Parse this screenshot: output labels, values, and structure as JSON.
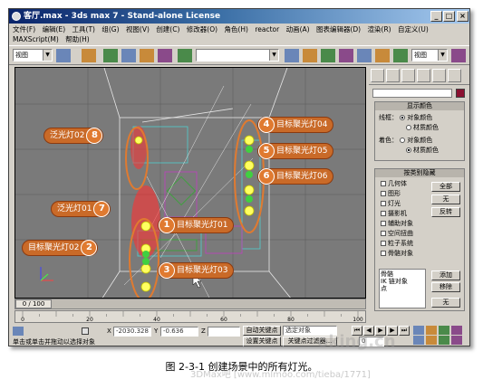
{
  "window": {
    "title": "客厅.max - 3ds max 7 - Stand-alone License"
  },
  "menu": [
    "文件(F)",
    "编辑(E)",
    "工具(T)",
    "组(G)",
    "视图(V)",
    "创建(C)",
    "修改器(O)",
    "角色(H)",
    "reactor",
    "动画(A)",
    "图表编辑器(D)",
    "渲染(R)",
    "自定义(U)",
    "MAXScript(M)",
    "帮助(H)"
  ],
  "toolbar": {
    "view_combo_left": "视图",
    "view_combo_right": "视图",
    "selection_set": ""
  },
  "callouts": [
    {
      "num": "1",
      "label": "目标聚光灯01"
    },
    {
      "num": "2",
      "label": "目标聚光灯02"
    },
    {
      "num": "3",
      "label": "目标聚光灯03"
    },
    {
      "num": "4",
      "label": "目标聚光灯04"
    },
    {
      "num": "5",
      "label": "目标聚光灯05"
    },
    {
      "num": "6",
      "label": "目标聚光灯06"
    },
    {
      "num": "7",
      "label": "泛光灯01"
    },
    {
      "num": "8",
      "label": "泛光灯02"
    }
  ],
  "panel": {
    "display_color": {
      "header": "显示颜色",
      "wireframe_label": "线框：",
      "shading_label": "着色：",
      "opt_object": "对象颜色",
      "opt_material": "材质颜色"
    },
    "hide_by_category": {
      "header": "按类别隐藏",
      "items": [
        "几何体",
        "图形",
        "灯光",
        "摄影机",
        "辅助对象",
        "空间扭曲",
        "粒子系统",
        "骨骼对象"
      ],
      "btn_all": "全部",
      "btn_none": "无",
      "btn_invert": "反转",
      "list_items": [
        "骨骼",
        "IK 链对象",
        "点"
      ],
      "btn_add": "添加",
      "btn_remove": "移除",
      "btn_none2": "无"
    }
  },
  "timeline": {
    "frame": "0 / 100",
    "ticks": [
      "0",
      "20",
      "40",
      "60",
      "80",
      "100"
    ]
  },
  "status": {
    "x_label": "X",
    "x_value": "-2030.328",
    "y_label": "Y",
    "y_value": "-0.636",
    "z_label": "Z",
    "auto_key": "自动关键点",
    "set_key": "设置关键点",
    "selected_combo": "选定对象",
    "key_filters": "关键点过滤器...",
    "prompt": "单击或单击并拖动以选择对象",
    "frame_field": "0"
  },
  "caption": "图 2-3-1   创建场景中的所有灯光。",
  "watermarks": [
    "oking.cn",
    "3DMax吧 [www.mlmoo.com/tieba/1771]"
  ],
  "colors": {
    "accent": "#c96a28",
    "window_bg": "#d4d0c8",
    "title_bar": "#0a246a"
  }
}
